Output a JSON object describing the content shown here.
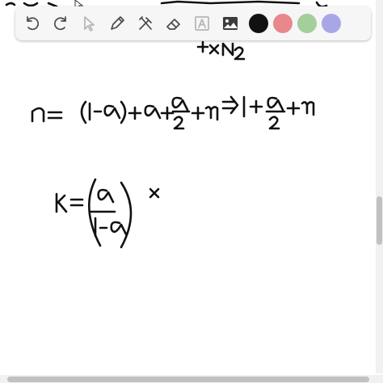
{
  "toolbar": {
    "tools": [
      {
        "name": "undo-icon",
        "enabled": true
      },
      {
        "name": "redo-icon",
        "enabled": true
      },
      {
        "name": "select-pointer-icon",
        "enabled": false
      },
      {
        "name": "pen-icon",
        "enabled": true
      },
      {
        "name": "tools-icon",
        "enabled": true
      },
      {
        "name": "eraser-icon",
        "enabled": true
      },
      {
        "name": "text-icon",
        "enabled": false
      },
      {
        "name": "image-icon",
        "enabled": true
      }
    ],
    "colors": [
      "#111111",
      "#e8878c",
      "#a2cf9a",
      "#a9a6e8"
    ]
  },
  "canvas": {
    "background": "#ffffff",
    "ink_color": "#111111"
  }
}
